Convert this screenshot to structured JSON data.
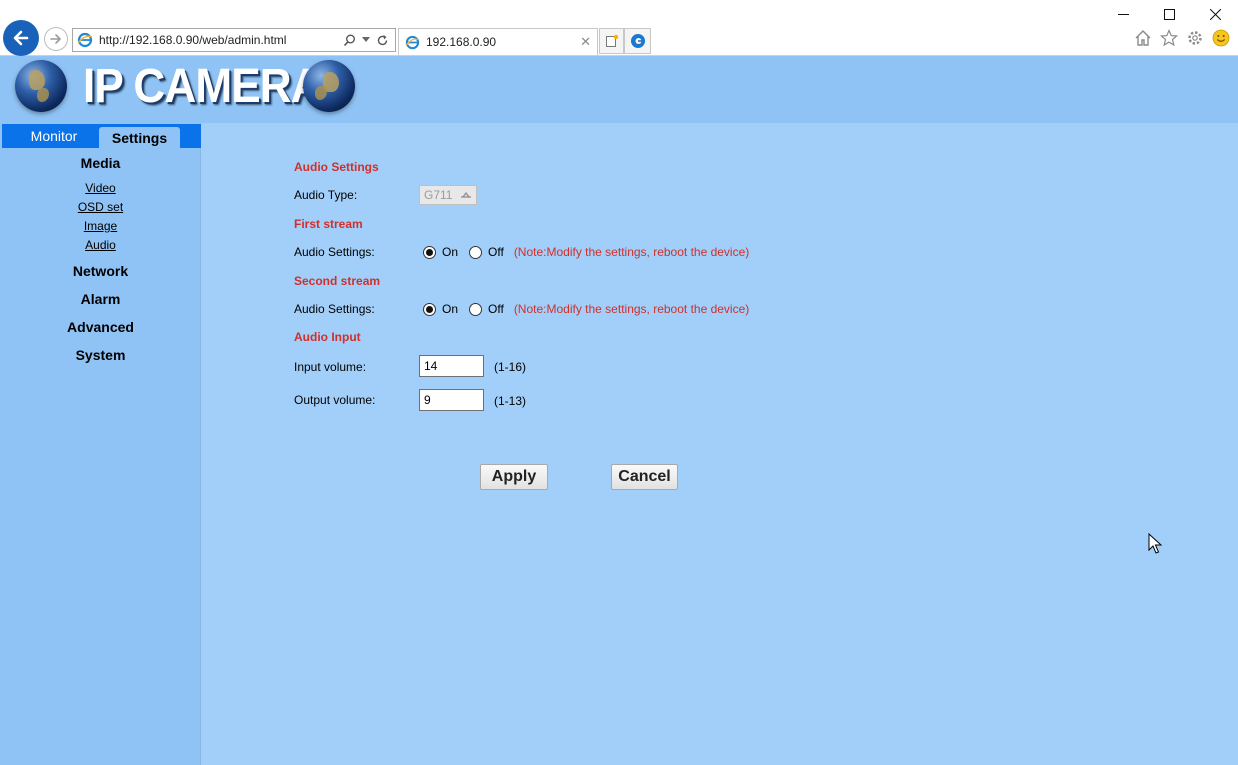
{
  "browser": {
    "url": "http://192.168.0.90/web/admin.html",
    "tab_title": "192.168.0.90",
    "icons": [
      "back-arrow-icon",
      "forward-arrow-icon",
      "ie-icon",
      "search-icon",
      "dropdown-icon",
      "refresh-icon",
      "close-icon",
      "new-tab-icon",
      "edge-icon",
      "minimize-icon",
      "maximize-icon",
      "window-close-icon",
      "home-icon",
      "favorites-star-icon",
      "settings-gear-icon",
      "smiley-icon"
    ]
  },
  "banner": {
    "logo_text": "IP CAMERA"
  },
  "sidebar": {
    "tabs": {
      "monitor": "Monitor",
      "settings": "Settings"
    },
    "groups": {
      "media": "Media",
      "network": "Network",
      "alarm": "Alarm",
      "advanced": "Advanced",
      "system": "System"
    },
    "media_links": {
      "video": "Video",
      "osd": "OSD set",
      "image": "Image",
      "audio": "Audio"
    }
  },
  "form": {
    "audio_settings_title": "Audio Settings",
    "audio_type_label": "Audio Type:",
    "audio_type_value": "G711",
    "first_stream_title": "First stream",
    "second_stream_title": "Second stream",
    "stream_audio_label": "Audio Settings:",
    "on_label": "On",
    "off_label": "Off",
    "note": "(Note:Modify the settings, reboot the device)",
    "first_stream_enabled": true,
    "second_stream_enabled": true,
    "audio_input_title": "Audio Input",
    "input_volume_label": "Input volume:",
    "input_volume_value": "14",
    "input_volume_range": "(1-16)",
    "output_volume_label": "Output volume:",
    "output_volume_value": "9",
    "output_volume_range": "(1-13)",
    "apply_label": "Apply",
    "cancel_label": "Cancel"
  },
  "colors": {
    "page_bg": "#8fc3f5",
    "content_bg": "#a2cffa",
    "tab_bar": "#0a73ea",
    "section_title": "#d0302a"
  }
}
